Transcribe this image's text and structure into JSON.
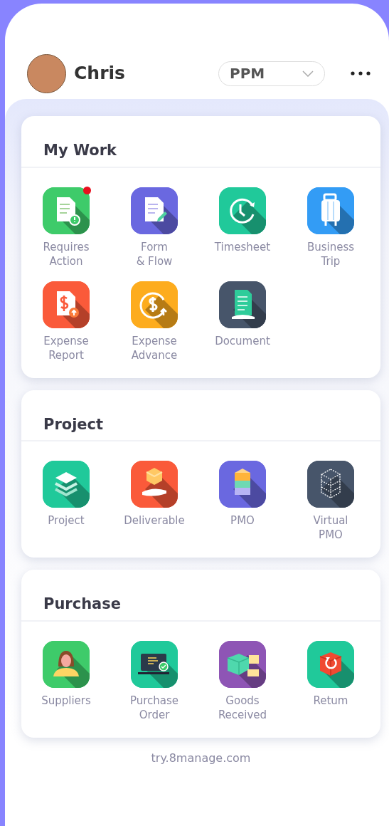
{
  "header": {
    "user": "Chris",
    "workspace": "PPM"
  },
  "sections": [
    {
      "title": "My Work",
      "items": [
        {
          "label": "Requires\nAction",
          "kind": "doc-alert",
          "color": "#3ecb6a",
          "badge": true
        },
        {
          "label": "Form\n& Flow",
          "kind": "doc-edit",
          "color": "#6a68e0",
          "badge": false
        },
        {
          "label": "Timesheet",
          "kind": "clock",
          "color": "#20c99a",
          "badge": false
        },
        {
          "label": "Business\nTrip",
          "kind": "suitcase",
          "color": "#339cf5",
          "badge": false
        },
        {
          "label": "Expense\nReport",
          "kind": "doc-dollar",
          "color": "#fa5a3a",
          "badge": false
        },
        {
          "label": "Expense\nAdvance",
          "kind": "coin",
          "color": "#fdac1e",
          "badge": false
        },
        {
          "label": "Document",
          "kind": "doc-hand",
          "color": "#47556a",
          "badge": false
        }
      ]
    },
    {
      "title": "Project",
      "items": [
        {
          "label": "Project",
          "kind": "layers",
          "color": "#20c99a",
          "badge": false
        },
        {
          "label": "Deliverable",
          "kind": "box-hand",
          "color": "#fa5a3a",
          "badge": false
        },
        {
          "label": "PMO",
          "kind": "stack",
          "color": "#6a68e0",
          "badge": false
        },
        {
          "label": "Virtual\nPMO",
          "kind": "cube",
          "color": "#47556a",
          "badge": false
        }
      ]
    },
    {
      "title": "Purchase",
      "items": [
        {
          "label": "Suppliers",
          "kind": "person",
          "color": "#3ecb6a",
          "badge": false
        },
        {
          "label": "Purchase\nOrder",
          "kind": "laptop",
          "color": "#20c99a",
          "badge": false
        },
        {
          "label": "Goods\nReceived",
          "kind": "package-hand",
          "color": "#8e55b5",
          "badge": false
        },
        {
          "label": "Retum",
          "kind": "box-return",
          "color": "#20c99a",
          "badge": false
        }
      ]
    }
  ],
  "footer": "try.8manage.com"
}
